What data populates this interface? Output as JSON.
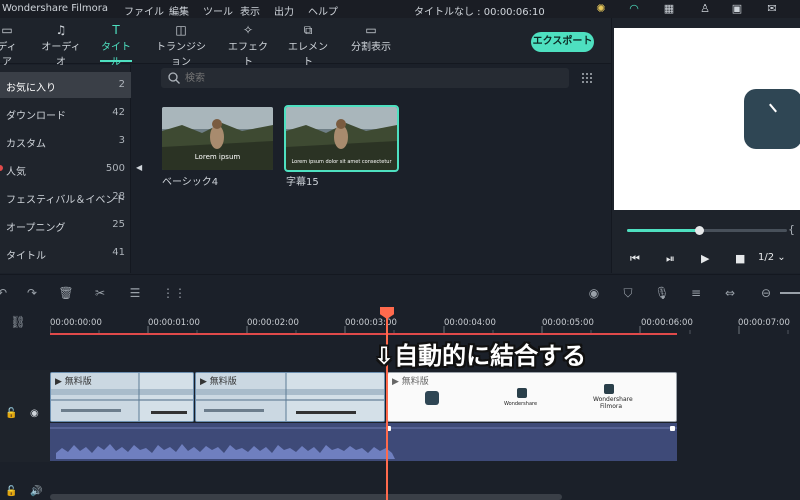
{
  "titlebar": {
    "app_name": "Wondershare Filmora",
    "menu": [
      "ファイル",
      "編集",
      "ツール",
      "表示",
      "出力",
      "ヘルプ"
    ],
    "project": "タイトルなし : 00:00:06:10"
  },
  "toolbar": {
    "tabs": [
      {
        "label": "ディア",
        "icon": "folder-icon"
      },
      {
        "label": "オーディオ",
        "icon": "music-note-icon"
      },
      {
        "label": "タイトル",
        "icon": "title-t-icon",
        "active": true
      },
      {
        "label": "トランジション",
        "icon": "transition-icon"
      },
      {
        "label": "エフェクト",
        "icon": "effect-icon"
      },
      {
        "label": "エレメント",
        "icon": "element-icon"
      },
      {
        "label": "分割表示",
        "icon": "split-screen-icon"
      }
    ],
    "export_label": "エクスポート"
  },
  "sidebar": {
    "items": [
      {
        "label": "お気に入り",
        "count": "2",
        "active": true
      },
      {
        "label": "ダウンロード",
        "count": "42"
      },
      {
        "label": "カスタム",
        "count": "3"
      },
      {
        "label": "人気",
        "count": "500"
      },
      {
        "label": "フェスティバル＆イベント",
        "count": "28"
      },
      {
        "label": "オープニング",
        "count": "25"
      },
      {
        "label": "タイトル",
        "count": "41"
      }
    ]
  },
  "search": {
    "placeholder": "検索"
  },
  "library": {
    "items": [
      {
        "label": "ベーシック4",
        "overlay": "Lorem ipsum"
      },
      {
        "label": "字幕15",
        "overlay": "Lorem ipsum dolor sit amet consectetur",
        "selected": true
      }
    ]
  },
  "preview": {
    "quality": "1/2",
    "progress": 0.45
  },
  "timeline": {
    "ticks": [
      "00:00:00:00",
      "00:00:01:00",
      "00:00:02:00",
      "00:00:03:00",
      "00:00:04:00",
      "00:00:05:00",
      "00:00:06:00",
      "00:00:07:00"
    ],
    "annotation": "自動的に結合する",
    "clips": [
      {
        "label": "無料版",
        "type": "video"
      },
      {
        "label": "無料版",
        "type": "video"
      },
      {
        "label": "無料版",
        "type": "title"
      }
    ],
    "title_clip_text": [
      "Wondershare",
      "Filmora"
    ]
  },
  "colors": {
    "accent": "#4ee0c0",
    "playhead": "#ff6a4d",
    "audio": "#3e4a78"
  }
}
